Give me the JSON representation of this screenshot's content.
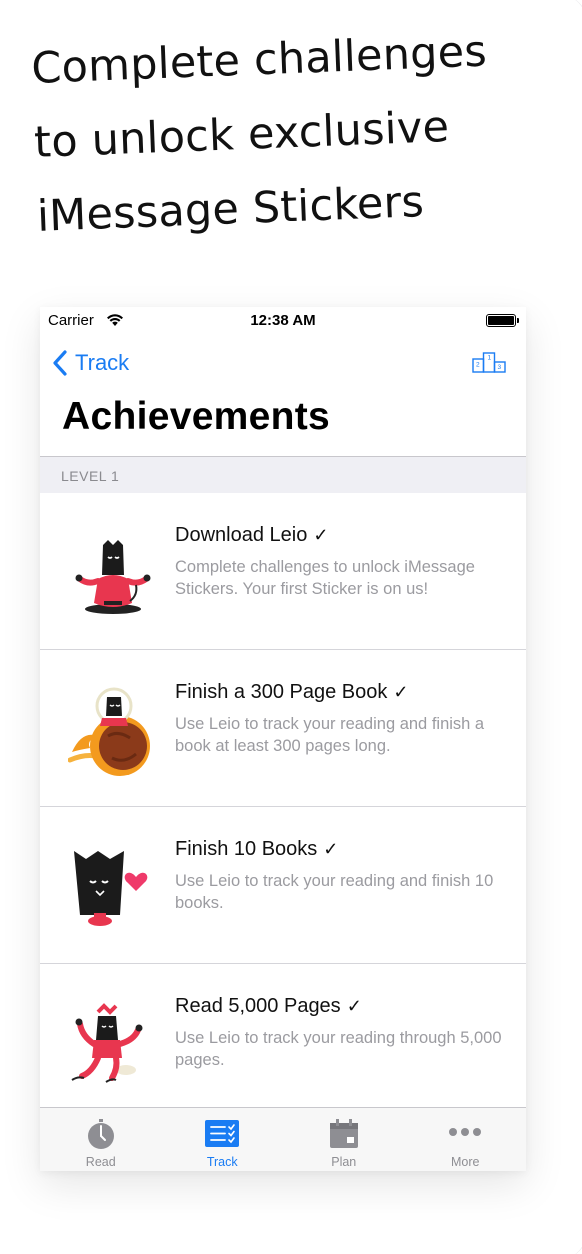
{
  "headline": {
    "line1": "Complete challenges",
    "line2": "to unlock exclusive",
    "line3": "iMessage Stickers"
  },
  "status_bar": {
    "carrier": "Carrier",
    "time": "12:38 AM",
    "signal_icon": "wifi-icon",
    "battery_icon": "battery-icon"
  },
  "nav": {
    "back_label": "Track",
    "back_icon": "chevron-left-icon",
    "right_icon": "podium-icon",
    "title": "Achievements",
    "accent_color": "#1a7cf3"
  },
  "section": {
    "label": "LEVEL 1"
  },
  "achievements": [
    {
      "title": "Download Leio",
      "check": "✓",
      "description": "Complete challenges to unlock iMessage Stickers. Your first Sticker is on us!",
      "icon": "meditating-book-sticker-icon"
    },
    {
      "title": "Finish a 300 Page Book",
      "check": "✓",
      "description": "Use Leio to track your reading and finish a book at least 300 pages long.",
      "icon": "astronaut-book-sticker-icon"
    },
    {
      "title": "Finish 10 Books",
      "check": "✓",
      "description": "Use Leio to track your reading and finish 10 books.",
      "icon": "book-with-heart-sticker-icon"
    },
    {
      "title": "Read 5,000 Pages",
      "check": "✓",
      "description": "Use Leio to track your reading through 5,000 pages.",
      "icon": "dancing-book-sticker-icon"
    }
  ],
  "tabs": [
    {
      "label": "Read",
      "icon": "stopwatch-icon",
      "active": false
    },
    {
      "label": "Track",
      "icon": "checklist-icon",
      "active": true
    },
    {
      "label": "Plan",
      "icon": "calendar-icon",
      "active": false
    },
    {
      "label": "More",
      "icon": "more-dots-icon",
      "active": false
    }
  ],
  "colors": {
    "tab_active": "#1a7cf3",
    "tab_inactive": "#8e8e93",
    "sticker_red": "#e8364f",
    "sticker_orange": "#f39a1e"
  }
}
